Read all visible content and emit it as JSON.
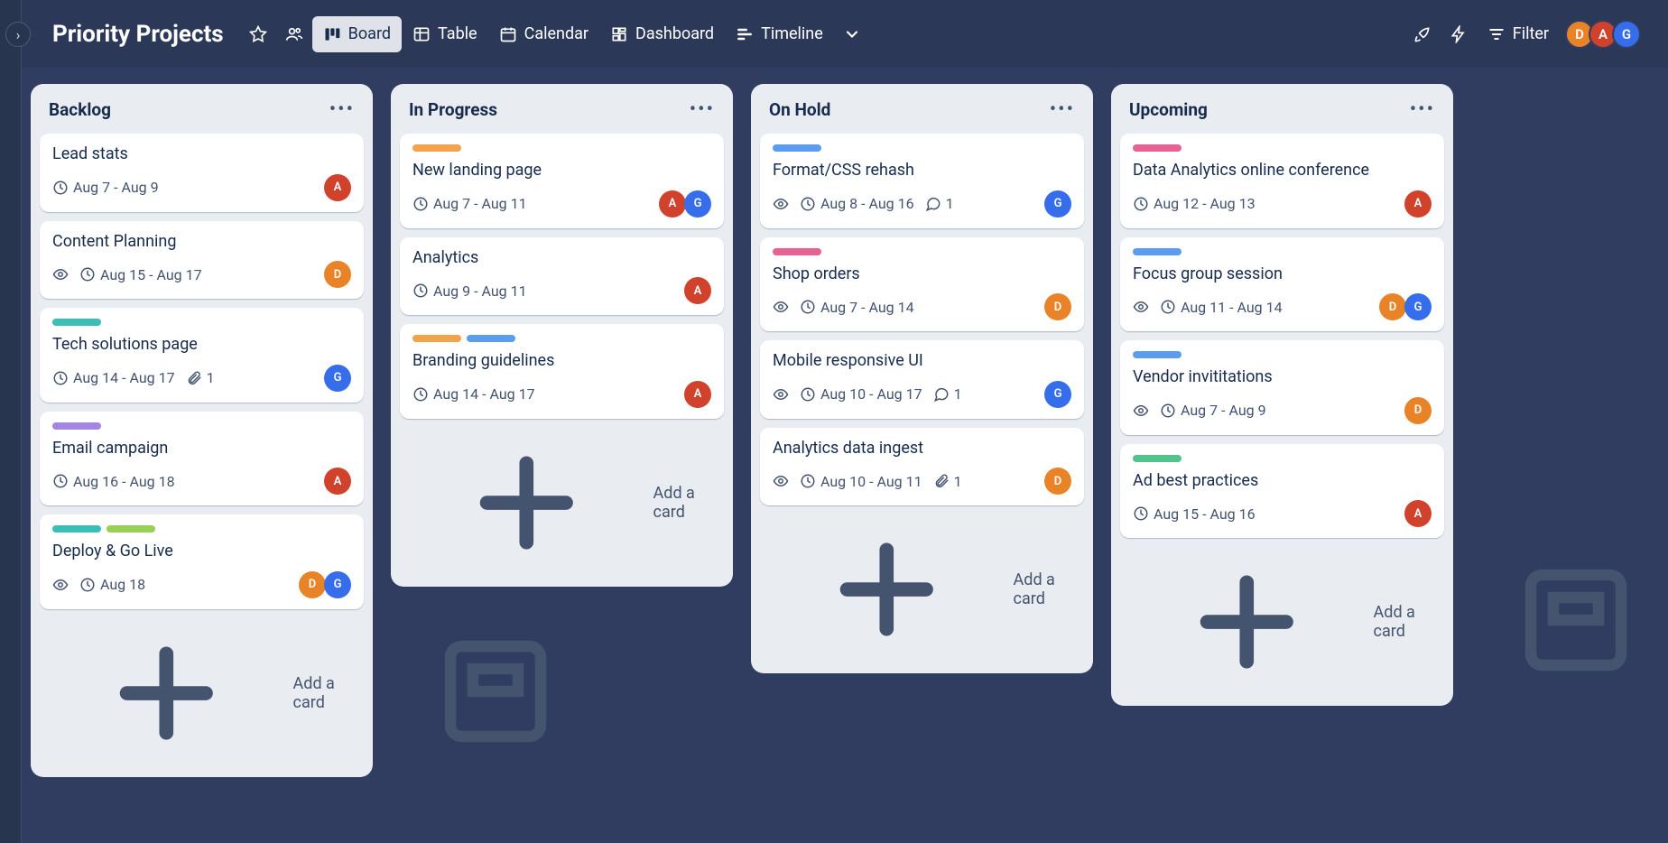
{
  "header": {
    "title": "Priority Projects",
    "views": {
      "board": "Board",
      "table": "Table",
      "calendar": "Calendar",
      "dashboard": "Dashboard",
      "timeline": "Timeline"
    },
    "filter": "Filter",
    "members": [
      {
        "initial": "D",
        "color": "av-D"
      },
      {
        "initial": "A",
        "color": "av-A"
      },
      {
        "initial": "G",
        "color": "av-G"
      }
    ]
  },
  "add_card_label": "Add a card",
  "lists": [
    {
      "name": "Backlog",
      "cards": [
        {
          "title": "Lead stats",
          "date": "Aug 7 - Aug 9",
          "members": [
            {
              "i": "A",
              "c": "av-A"
            }
          ]
        },
        {
          "title": "Content Planning",
          "watch": true,
          "date": "Aug 15 - Aug 17",
          "members": [
            {
              "i": "D",
              "c": "av-D"
            }
          ]
        },
        {
          "labels": [
            "lb-teal"
          ],
          "title": "Tech solutions page",
          "date": "Aug 14 - Aug 17",
          "attach": "1",
          "members": [
            {
              "i": "G",
              "c": "av-G"
            }
          ]
        },
        {
          "labels": [
            "lb-purple"
          ],
          "title": "Email campaign",
          "date": "Aug 16 - Aug 18",
          "members": [
            {
              "i": "A",
              "c": "av-A"
            }
          ]
        },
        {
          "labels": [
            "lb-teal",
            "lb-lime"
          ],
          "title": "Deploy & Go Live",
          "watch": true,
          "date": "Aug 18",
          "members": [
            {
              "i": "D",
              "c": "av-D"
            },
            {
              "i": "G",
              "c": "av-G"
            }
          ]
        }
      ]
    },
    {
      "name": "In Progress",
      "cards": [
        {
          "labels": [
            "lb-orange"
          ],
          "title": "New landing page",
          "date": "Aug 7 - Aug 11",
          "members": [
            {
              "i": "A",
              "c": "av-A"
            },
            {
              "i": "G",
              "c": "av-G"
            }
          ]
        },
        {
          "title": "Analytics",
          "date": "Aug 9 - Aug 11",
          "members": [
            {
              "i": "A",
              "c": "av-A"
            }
          ]
        },
        {
          "labels": [
            "lb-orange",
            "lb-blue"
          ],
          "title": "Branding guidelines",
          "date": "Aug 14 - Aug 17",
          "members": [
            {
              "i": "A",
              "c": "av-A"
            }
          ]
        }
      ]
    },
    {
      "name": "On Hold",
      "cards": [
        {
          "labels": [
            "lb-blue"
          ],
          "title": "Format/CSS rehash",
          "watch": true,
          "date": "Aug 8 - Aug 16",
          "comments": "1",
          "members": [
            {
              "i": "G",
              "c": "av-G"
            }
          ]
        },
        {
          "labels": [
            "lb-pink"
          ],
          "title": "Shop orders",
          "watch": true,
          "date": "Aug 7 - Aug 14",
          "members": [
            {
              "i": "D",
              "c": "av-D"
            }
          ]
        },
        {
          "title": "Mobile responsive UI",
          "watch": true,
          "date": "Aug 10 - Aug 17",
          "comments": "1",
          "members": [
            {
              "i": "G",
              "c": "av-G"
            }
          ]
        },
        {
          "title": "Analytics data ingest",
          "watch": true,
          "date": "Aug 10 - Aug 11",
          "attach": "1",
          "members": [
            {
              "i": "D",
              "c": "av-D"
            }
          ]
        }
      ]
    },
    {
      "name": "Upcoming",
      "cards": [
        {
          "labels": [
            "lb-pink"
          ],
          "title": "Data Analytics online conference",
          "date": "Aug 12 - Aug 13",
          "members": [
            {
              "i": "A",
              "c": "av-A"
            }
          ]
        },
        {
          "labels": [
            "lb-blue"
          ],
          "title": "Focus group session",
          "watch": true,
          "date": "Aug 11 - Aug 14",
          "members": [
            {
              "i": "D",
              "c": "av-D"
            },
            {
              "i": "G",
              "c": "av-G"
            }
          ]
        },
        {
          "labels": [
            "lb-blue"
          ],
          "title": "Vendor invititations",
          "watch": true,
          "date": "Aug 7 - Aug 9",
          "members": [
            {
              "i": "D",
              "c": "av-D"
            }
          ]
        },
        {
          "labels": [
            "lb-green"
          ],
          "title": "Ad best practices",
          "date": "Aug 15 - Aug 16",
          "members": [
            {
              "i": "A",
              "c": "av-A"
            }
          ]
        }
      ]
    }
  ]
}
